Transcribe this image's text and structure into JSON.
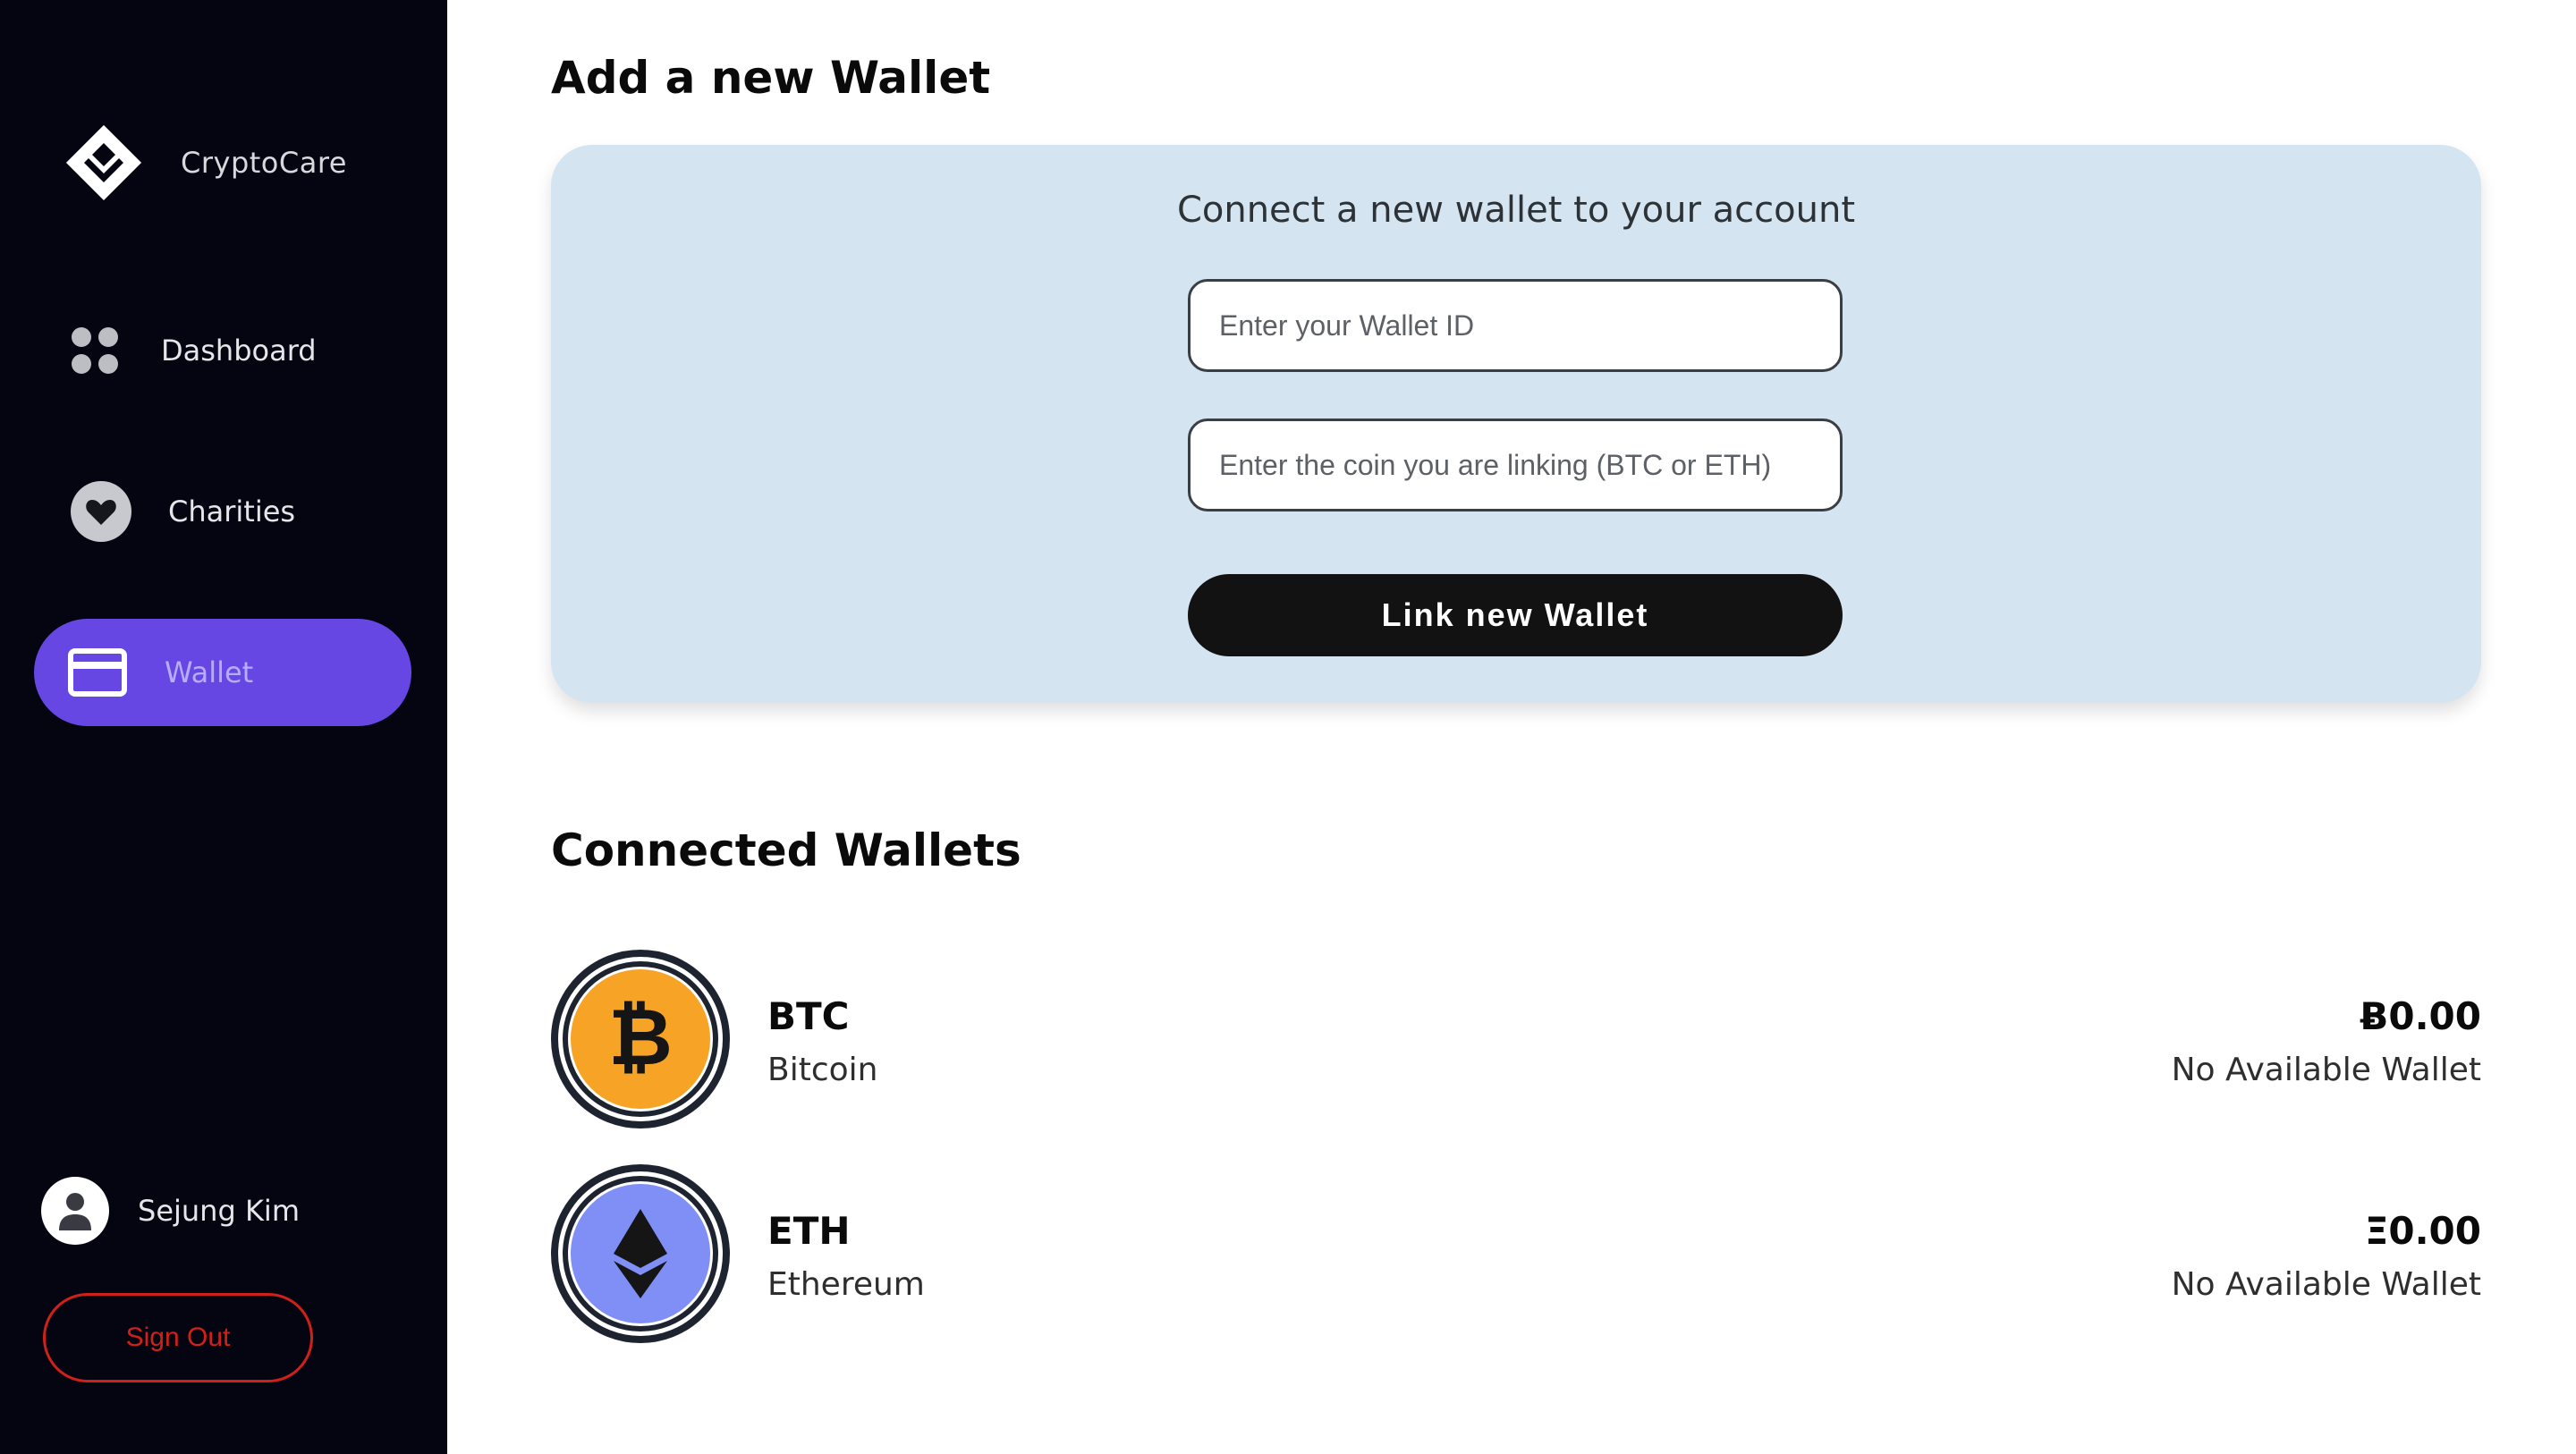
{
  "app": {
    "name": "CryptoCare"
  },
  "sidebar": {
    "items": [
      {
        "label": "Dashboard",
        "icon": "dashboard-grid-icon"
      },
      {
        "label": "Charities",
        "icon": "heart-icon"
      },
      {
        "label": "Wallet",
        "icon": "credit-card-icon",
        "active": true
      }
    ],
    "user": {
      "name": "Sejung Kim",
      "icon": "user-avatar-icon"
    },
    "signout_label": "Sign Out"
  },
  "main": {
    "title": "Add a new Wallet",
    "form": {
      "heading": "Connect a new wallet to your account",
      "wallet_id_placeholder": "Enter your Wallet ID",
      "coin_placeholder": "Enter the coin you are linking (BTC or ETH)",
      "submit_label": "Link new Wallet"
    },
    "connected_title": "Connected Wallets",
    "wallets": [
      {
        "symbol": "BTC",
        "name": "Bitcoin",
        "balance": "Ƀ0.00",
        "status": "No Available Wallet",
        "color": "#f7a325",
        "icon": "bitcoin-icon"
      },
      {
        "symbol": "ETH",
        "name": "Ethereum",
        "balance": "Ξ0.00",
        "status": "No Available Wallet",
        "color": "#7f8ff5",
        "icon": "ethereum-icon"
      }
    ]
  },
  "colors": {
    "sidebar_bg": "#050511",
    "accent": "#6647e3",
    "card_bg": "#d5e4f1",
    "danger": "#d0201a",
    "button_bg": "#121212"
  }
}
